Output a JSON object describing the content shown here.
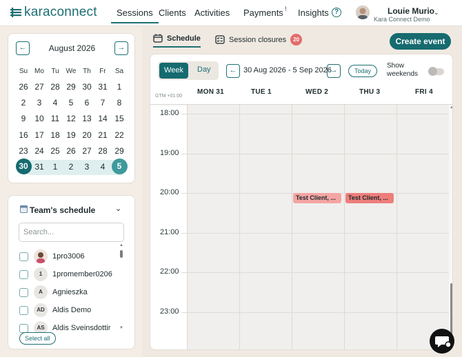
{
  "logo": {
    "text": "karaconnect"
  },
  "nav": {
    "sessions": "Sessions",
    "clients": "Clients",
    "activities": "Activities",
    "payments": "Payments",
    "payments_badge": "!",
    "insights": "Insights"
  },
  "user": {
    "name": "Louie Murio",
    "org": "Kara Connect Demo"
  },
  "calendar": {
    "title": "August 2026",
    "weekdays": [
      "Su",
      "Mo",
      "Tu",
      "We",
      "Th",
      "Fr",
      "Sa"
    ],
    "weeks": [
      [
        "26",
        "27",
        "28",
        "29",
        "30",
        "31",
        "1"
      ],
      [
        "2",
        "3",
        "4",
        "5",
        "6",
        "7",
        "8"
      ],
      [
        "9",
        "10",
        "11",
        "12",
        "13",
        "14",
        "15"
      ],
      [
        "16",
        "17",
        "18",
        "19",
        "20",
        "21",
        "22"
      ],
      [
        "23",
        "24",
        "25",
        "26",
        "27",
        "28",
        "29"
      ],
      [
        "30",
        "31",
        "1",
        "2",
        "3",
        "4",
        "5"
      ]
    ]
  },
  "team": {
    "title": "Team's schedule",
    "search_placeholder": "Search...",
    "members": [
      {
        "initials": "",
        "name": "1pro3006",
        "has_photo": true
      },
      {
        "initials": "1",
        "name": "1promember0206"
      },
      {
        "initials": "A",
        "name": "Agnieszka"
      },
      {
        "initials": "AD",
        "name": "Aldis Demo"
      },
      {
        "initials": "AS",
        "name": "Aldis Sveinsdottir"
      }
    ],
    "select_all": "Select all"
  },
  "tabs": {
    "schedule": "Schedule",
    "closures": "Session closures",
    "closures_count": "20"
  },
  "create_event": "Create event",
  "toolbar": {
    "week": "Week",
    "day": "Day",
    "range": "30 Aug 2026 - 5 Sep 2026",
    "today": "Today",
    "show_weekends_1": "Show",
    "show_weekends_2": "weekends",
    "show_weekends_on": false
  },
  "grid": {
    "timezone": "GTM +01:00",
    "days": [
      "MON  31",
      "TUE  1",
      "WED  2",
      "THU  3",
      "FRI  4"
    ],
    "hours": [
      "18:00",
      "19:00",
      "20:00",
      "21:00",
      "22:00",
      "23:00"
    ],
    "events": [
      {
        "day": "WED  2",
        "label": "Test Client, ...",
        "color": "#f4a5a3"
      },
      {
        "day": "THU  3",
        "label": "Test Client, ...",
        "color": "#ee7e7b"
      }
    ]
  },
  "colors": {
    "brand": "#156b6f",
    "badge": "#e36c6c",
    "event_light": "#f4a5a3",
    "event_dark": "#ee7e7b"
  }
}
